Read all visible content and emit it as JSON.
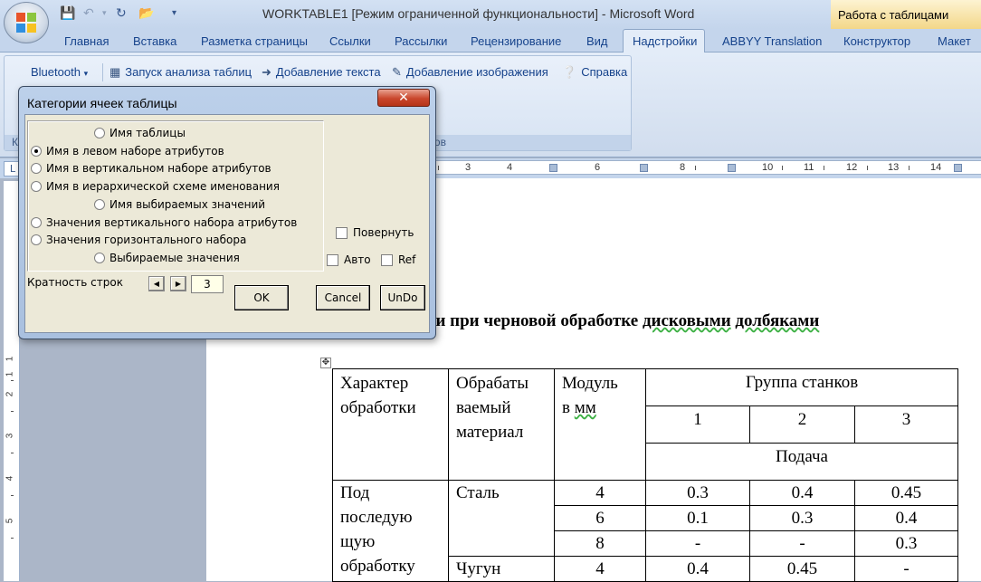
{
  "titlebar": {
    "doc_title": "WORKTABLE1 [Режим ограниченной функциональности] - Microsoft Word",
    "context_tab": "Работа с таблицами"
  },
  "tabs": [
    "Главная",
    "Вставка",
    "Разметка страницы",
    "Ссылки",
    "Рассылки",
    "Рецензирование",
    "Вид",
    "Надстройки",
    "ABBYY Translation",
    "Конструктор",
    "Макет"
  ],
  "active_tab": "Надстройки",
  "ribbon": {
    "bluetooth": "Bluetooth",
    "dropdown_glyph": "▾",
    "run_analysis": "Запуск анализа таблиц",
    "add_text": "Добавление текста",
    "add_image": "Добавление изображения",
    "help": "Справка",
    "group_caption_left": "К",
    "group_caption_right": "ментов"
  },
  "ruler": {
    "h_numbers": [
      "3",
      "4",
      "5",
      "6",
      "7",
      "8",
      "9",
      "10",
      "11",
      "12",
      "13",
      "14"
    ],
    "v_numbers": [
      "1",
      "1",
      "2",
      "3",
      "4",
      "5"
    ],
    "tab_marker": "L"
  },
  "dialog": {
    "title": "Категории ячеек таблицы",
    "close": "✕",
    "options": [
      {
        "label": "Имя таблицы",
        "selected": false
      },
      {
        "label": "Имя в левом наборе атрибутов",
        "selected": true
      },
      {
        "label": "Имя в вертикальном наборе атрибутов",
        "selected": false
      },
      {
        "label": "Имя в иерархической схеме именования",
        "selected": false
      },
      {
        "label": "Имя выбираемых значений",
        "selected": false
      },
      {
        "label": "Значения вертикального набора  атрибутов",
        "selected": false
      },
      {
        "label": "Значения горизонтального набора",
        "selected": false
      },
      {
        "label": "Выбираемые значения",
        "selected": false
      }
    ],
    "rotate": "Повернуть",
    "auto": "Авто",
    "ref": "Ref",
    "multiplicity_label": "Кратность строк",
    "spin_left": "◀",
    "spin_right": "▶",
    "multiplicity_value": "3",
    "ok": "OK",
    "cancel": "Cancel",
    "undo": "UnDo"
  },
  "document": {
    "heading_plain": "ачи при черновой обработке ",
    "heading_sq1": "дисковыми",
    "heading_space": " ",
    "heading_sq2": "долбяками",
    "move_handle": "✥",
    "table": {
      "h_char_1": "Характер",
      "h_char_2": "обработки",
      "h_mat_1": "Обрабаты",
      "h_mat_2": "ваемый",
      "h_mat_3": "материал",
      "h_mod_1": "Модуль",
      "h_mod_2a": "в ",
      "h_mod_2b": "мм",
      "h_group": "Группа станков",
      "g1": "1",
      "g2": "2",
      "g3": "3",
      "h_feed": "Подача",
      "r_proc_1": "Под",
      "r_proc_2": "последую",
      "r_proc_3": "щую",
      "r_proc_4": "обработку",
      "steel": "Сталь",
      "iron": "Чугун",
      "rows": [
        [
          "4",
          "0.3",
          "0.4",
          "0.45"
        ],
        [
          "6",
          "0.1",
          "0.3",
          "0.4"
        ],
        [
          "8",
          "-",
          "-",
          "0.3"
        ],
        [
          "4",
          "0.4",
          "0.45",
          "-"
        ]
      ]
    }
  }
}
